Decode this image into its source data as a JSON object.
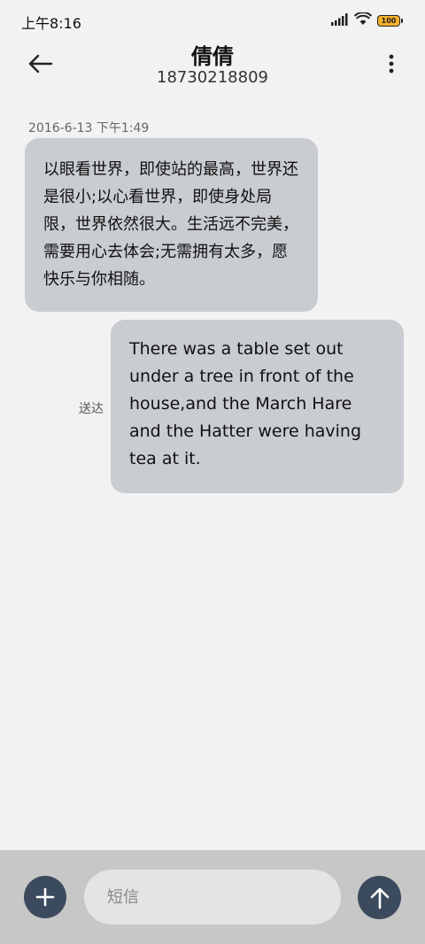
{
  "status_bar": {
    "time": "上午8:16",
    "battery_level": "100",
    "signal_icon": "signal-icon",
    "wifi_icon": "wifi-icon"
  },
  "header": {
    "contact_name": "倩倩",
    "contact_number": "18730218809",
    "back_icon": "arrow-left-icon",
    "more_icon": "more-vertical-icon"
  },
  "messages": [
    {
      "timestamp": "2016-6-13 下午1:49",
      "direction": "incoming",
      "text": "以眼看世界，即使站的最高，世界还是很小;以心看世界，即使身处局限，世界依然很大。生活远不完美，需要用心去体会;无需拥有太多，愿快乐与你相随。"
    },
    {
      "direction": "outgoing",
      "status": "送达",
      "text": "There was a table set out under a tree in front of the house,and the March Hare and the Hatter were having tea at it."
    }
  ],
  "composer": {
    "placeholder": "短信",
    "value": "",
    "add_icon": "plus-icon",
    "send_icon": "arrow-up-icon"
  },
  "colors": {
    "background": "#f2f2f2",
    "bubble": "#c9ccd0",
    "accent_button": "#3c4a5e",
    "composer_bar": "#c7c7c7",
    "battery": "#f6b12b"
  }
}
